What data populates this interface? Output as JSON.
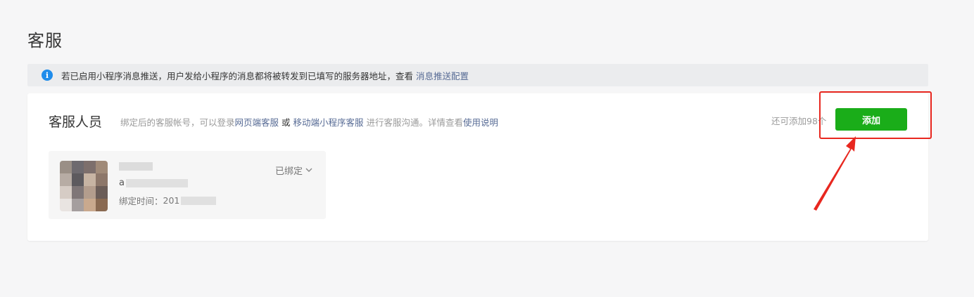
{
  "page": {
    "title": "客服"
  },
  "notice": {
    "text": "若已启用小程序消息推送，用户发给小程序的消息都将被转发到已填写的服务器地址，查看",
    "link": "消息推送配置"
  },
  "section": {
    "title": "客服人员",
    "desc_prefix": "绑定后的客服帐号，可以登录",
    "desc_link_web": "网页端客服",
    "desc_or": " 或 ",
    "desc_link_mobile": "移动端小程序客服",
    "desc_mid": " 进行客服沟通。详情查看",
    "desc_link_help": "使用说明",
    "remaining": "还可添加98个",
    "add_label": "添加"
  },
  "agent": {
    "account_prefix": "a",
    "time_label": "绑定时间：",
    "time_value_prefix": "201",
    "status": "已绑定"
  },
  "colors": {
    "accent_green": "#1aad19",
    "link": "#576b95",
    "annotation_red": "#e8271f",
    "info_blue": "#1f8ceb"
  },
  "icons": {
    "info": "info-icon",
    "chevron": "chevron-down-icon"
  }
}
